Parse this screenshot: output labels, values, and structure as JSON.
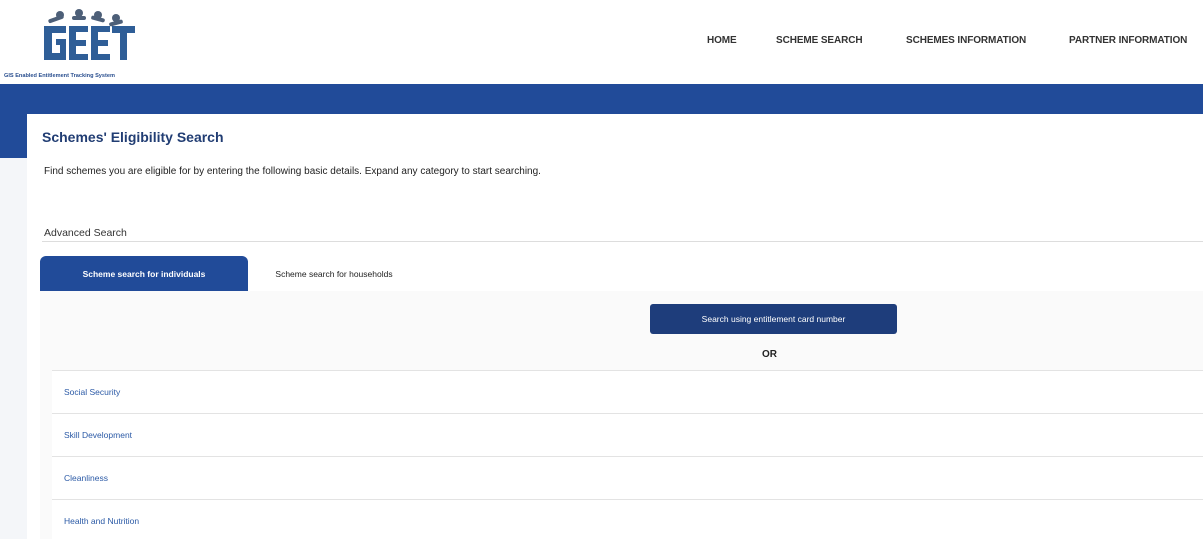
{
  "header": {
    "logo_text": "GEET",
    "logo_tagline": "GIS Enabled Entitlement Tracking System",
    "nav": [
      {
        "label": "HOME"
      },
      {
        "label": "SCHEME SEARCH"
      },
      {
        "label": "SCHEMES INFORMATION"
      },
      {
        "label": "PARTNER INFORMATION"
      }
    ]
  },
  "page": {
    "title": "Schemes' Eligibility Search",
    "intro": "Find schemes you are eligible for by entering the following basic details. Expand any category to start searching.",
    "advanced_search": "Advanced Search"
  },
  "tabs": [
    {
      "label": "Scheme search for individuals",
      "active": true
    },
    {
      "label": "Scheme search for households",
      "active": false
    }
  ],
  "panel": {
    "entitlement_button": "Search using entitlement card number",
    "or_text": "OR",
    "categories": [
      {
        "label": "Social Security"
      },
      {
        "label": "Skill Development"
      },
      {
        "label": "Cleanliness"
      },
      {
        "label": "Health and Nutrition"
      }
    ]
  },
  "colors": {
    "brand_blue": "#214b99",
    "button_blue": "#1e3d7b",
    "title_blue": "#213d73",
    "link_blue": "#2b5aa6"
  }
}
